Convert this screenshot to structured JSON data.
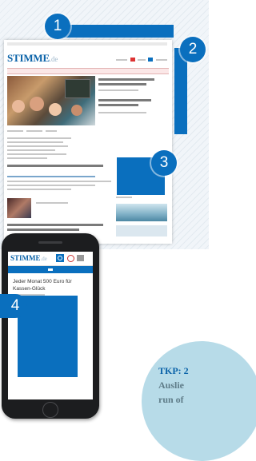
{
  "colors": {
    "accent": "#0a6fbe",
    "callout_bg": "#b7dbe8",
    "hatch": "#e3eaf0"
  },
  "badges": {
    "b1": "1",
    "b2": "2",
    "b3": "3",
    "b4": "4"
  },
  "desktop": {
    "logo": "STIMME",
    "logo_suffix": ".de"
  },
  "mobile": {
    "logo": "STIMME",
    "logo_suffix": ".de",
    "headline": "Jeder Monat 500 Euro für Kassen-Glück",
    "icons": [
      "search-icon",
      "user-icon",
      "menu-icon"
    ]
  },
  "callout": {
    "title": "TKP: 2",
    "line1": "Auslie",
    "line2": "run of"
  }
}
